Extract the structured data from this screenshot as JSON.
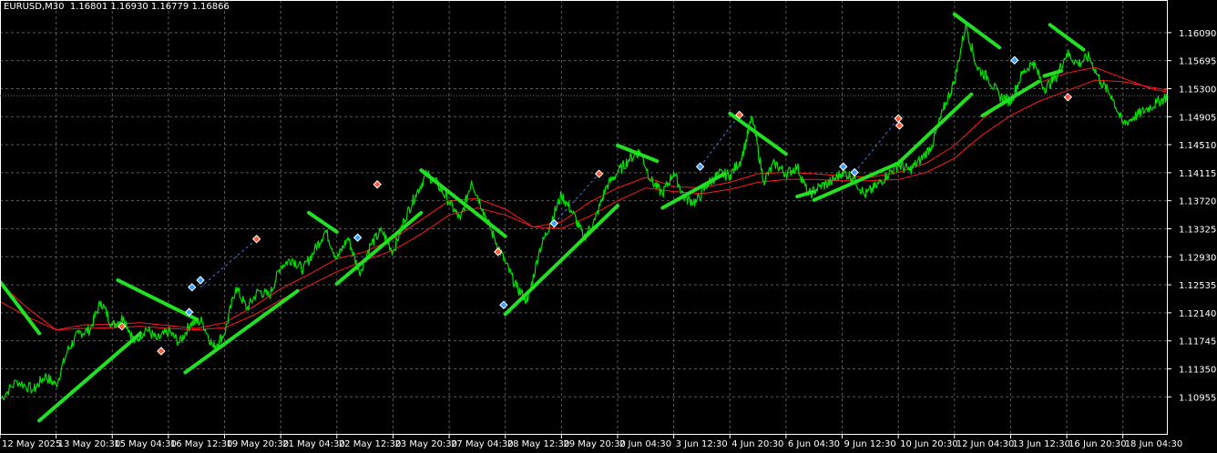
{
  "header": {
    "symbol": "EURUSD,M30",
    "ohlc": "1.16801 1.16930 1.16779 1.16866"
  },
  "chart_data": {
    "type": "line",
    "title": "EURUSD,M30",
    "ylim": [
      1.1042,
      1.1655
    ],
    "grid": true,
    "colors": {
      "background": "#000000",
      "price": "#00e000",
      "ma": "#ff1a1a",
      "trend": "#22e022",
      "grid": "#5a5a5a",
      "axis_text": "#ffffff",
      "buy_arrow": "#3aa0ff",
      "sell_arrow": "#ff5a3a"
    },
    "y_ticks": [
      "1.16090",
      "1.15695",
      "1.15300",
      "1.14905",
      "1.14510",
      "1.14115",
      "1.13720",
      "1.13325",
      "1.12930",
      "1.12535",
      "1.12140",
      "1.11745",
      "1.11350",
      "1.10955"
    ],
    "x_ticks": [
      "12 May 2025",
      "13 May 20:30",
      "15 May 04:30",
      "16 May 12:30",
      "19 May 20:30",
      "21 May 04:30",
      "22 May 12:30",
      "23 May 20:30",
      "27 May 04:30",
      "28 May 12:30",
      "29 May 20:30",
      "2 Jun 04:30",
      "3 Jun 12:30",
      "4 Jun 20:30",
      "6 Jun 04:30",
      "9 Jun 12:30",
      "10 Jun 20:30",
      "12 Jun 04:30",
      "13 Jun 12:30",
      "16 Jun 20:30",
      "18 Jun 04:30"
    ],
    "series": [
      {
        "role": "price",
        "x": [
          0.0,
          0.3,
          0.6,
          0.8,
          1.0,
          1.2,
          1.4,
          1.6,
          1.8,
          2.0,
          2.2,
          2.4,
          2.6,
          2.8,
          3.0,
          3.2,
          3.4,
          3.6,
          3.8,
          4.0,
          4.2,
          4.4,
          4.6,
          4.8,
          5.0,
          5.2,
          5.4,
          5.6,
          5.8,
          6.0,
          6.2,
          6.4,
          6.6,
          6.8,
          7.0,
          7.2,
          7.4,
          7.6,
          7.8,
          8.0,
          8.2,
          8.4,
          8.6,
          8.8,
          9.0,
          9.2,
          9.4,
          9.6,
          9.8,
          10.0,
          10.2,
          10.4,
          10.6,
          10.8,
          11.0,
          11.2,
          11.4,
          11.6,
          11.8,
          12.0,
          12.2,
          12.4,
          12.6,
          12.8,
          13.0,
          13.2,
          13.4,
          13.6,
          13.8,
          14.0,
          14.2,
          14.4,
          14.6,
          14.8,
          15.0,
          15.2,
          15.4,
          15.6,
          15.8,
          16.0,
          16.2,
          16.4,
          16.6,
          16.8,
          17.0,
          17.2,
          17.4,
          17.6,
          17.8,
          18.0,
          18.2,
          18.4,
          18.6,
          18.8,
          19.0,
          19.2,
          19.4,
          19.6,
          19.8,
          20.0,
          20.2,
          20.4,
          20.6,
          20.8
        ],
        "values": [
          1.1092,
          1.1118,
          1.1105,
          1.1125,
          1.1112,
          1.116,
          1.1185,
          1.119,
          1.123,
          1.1196,
          1.1208,
          1.1172,
          1.1192,
          1.1176,
          1.1188,
          1.1172,
          1.12,
          1.1202,
          1.1165,
          1.1185,
          1.125,
          1.122,
          1.1245,
          1.1238,
          1.128,
          1.129,
          1.1275,
          1.1302,
          1.133,
          1.129,
          1.132,
          1.127,
          1.131,
          1.133,
          1.13,
          1.1345,
          1.138,
          1.141,
          1.1395,
          1.137,
          1.1345,
          1.14,
          1.136,
          1.132,
          1.1285,
          1.125,
          1.123,
          1.13,
          1.134,
          1.138,
          1.1355,
          1.132,
          1.1345,
          1.1392,
          1.1412,
          1.143,
          1.1442,
          1.14,
          1.1382,
          1.1412,
          1.1375,
          1.137,
          1.1395,
          1.141,
          1.1408,
          1.143,
          1.149,
          1.14,
          1.1425,
          1.141,
          1.142,
          1.138,
          1.1392,
          1.1398,
          1.1412,
          1.1405,
          1.138,
          1.1392,
          1.1408,
          1.1423,
          1.1415,
          1.143,
          1.145,
          1.15,
          1.154,
          1.162,
          1.156,
          1.1545,
          1.152,
          1.1512,
          1.155,
          1.1568,
          1.153,
          1.1545,
          1.158,
          1.1565,
          1.1575,
          1.154,
          1.152,
          1.148,
          1.149,
          1.15,
          1.151,
          1.152
        ]
      },
      {
        "role": "ma_fast",
        "x": [
          0.0,
          0.5,
          1.0,
          1.5,
          2.0,
          2.5,
          3.0,
          3.5,
          4.0,
          4.5,
          5.0,
          5.5,
          6.0,
          6.5,
          7.0,
          7.5,
          8.0,
          8.5,
          9.0,
          9.5,
          10.0,
          10.5,
          11.0,
          11.5,
          12.0,
          12.5,
          13.0,
          13.5,
          14.0,
          14.5,
          15.0,
          15.5,
          16.0,
          16.5,
          17.0,
          17.5,
          18.0,
          18.5,
          19.0,
          19.5,
          20.0,
          20.5,
          20.8
        ],
        "values": [
          1.1255,
          1.122,
          1.119,
          1.1197,
          1.1198,
          1.12,
          1.1196,
          1.1192,
          1.12,
          1.1222,
          1.1248,
          1.1268,
          1.129,
          1.13,
          1.1318,
          1.1345,
          1.1372,
          1.1375,
          1.136,
          1.1335,
          1.1342,
          1.137,
          1.139,
          1.1405,
          1.1392,
          1.139,
          1.1398,
          1.141,
          1.1412,
          1.141,
          1.1407,
          1.1405,
          1.1412,
          1.1425,
          1.145,
          1.1487,
          1.1518,
          1.1538,
          1.1552,
          1.156,
          1.1545,
          1.153,
          1.1525
        ]
      },
      {
        "role": "ma_slow",
        "x": [
          0.0,
          0.5,
          1.0,
          1.5,
          2.0,
          2.5,
          3.0,
          3.5,
          4.0,
          4.5,
          5.0,
          5.5,
          6.0,
          6.5,
          7.0,
          7.5,
          8.0,
          8.5,
          9.0,
          9.5,
          10.0,
          10.5,
          11.0,
          11.5,
          12.0,
          12.5,
          13.0,
          13.5,
          14.0,
          14.5,
          15.0,
          15.5,
          16.0,
          16.5,
          17.0,
          17.5,
          18.0,
          18.5,
          19.0,
          19.5,
          20.0,
          20.5,
          20.8
        ],
        "values": [
          1.123,
          1.1208,
          1.119,
          1.1192,
          1.1193,
          1.1195,
          1.1192,
          1.119,
          1.1193,
          1.121,
          1.1232,
          1.1252,
          1.1272,
          1.1288,
          1.1302,
          1.1325,
          1.1352,
          1.1362,
          1.1352,
          1.1335,
          1.1333,
          1.135,
          1.1372,
          1.139,
          1.1385,
          1.1382,
          1.1388,
          1.1398,
          1.1402,
          1.1402,
          1.14,
          1.14,
          1.1402,
          1.1412,
          1.1432,
          1.1465,
          1.1492,
          1.1512,
          1.1527,
          1.1542,
          1.154,
          1.1532,
          1.1528
        ]
      }
    ],
    "trend_lines": [
      {
        "x": [
          0.0,
          0.7
        ],
        "values": [
          1.1258,
          1.1185
        ]
      },
      {
        "x": [
          0.7,
          2.5
        ],
        "values": [
          1.1062,
          1.1185
        ]
      },
      {
        "x": [
          2.1,
          3.5
        ],
        "values": [
          1.126,
          1.1205
        ]
      },
      {
        "x": [
          3.3,
          5.3
        ],
        "values": [
          1.113,
          1.1245
        ]
      },
      {
        "x": [
          5.5,
          6.0
        ],
        "values": [
          1.1355,
          1.1328
        ]
      },
      {
        "x": [
          6.0,
          7.5
        ],
        "values": [
          1.1255,
          1.1355
        ]
      },
      {
        "x": [
          7.5,
          9.0
        ],
        "values": [
          1.1415,
          1.1322
        ]
      },
      {
        "x": [
          9.0,
          11.0
        ],
        "values": [
          1.1212,
          1.1365
        ]
      },
      {
        "x": [
          11.0,
          11.7
        ],
        "values": [
          1.145,
          1.1428
        ]
      },
      {
        "x": [
          11.8,
          12.9
        ],
        "values": [
          1.1362,
          1.141
        ]
      },
      {
        "x": [
          13.0,
          14.0
        ],
        "values": [
          1.1495,
          1.1438
        ]
      },
      {
        "x": [
          14.2,
          14.5
        ],
        "values": [
          1.1378,
          1.1385
        ]
      },
      {
        "x": [
          14.5,
          16.0
        ],
        "values": [
          1.1373,
          1.1425
        ]
      },
      {
        "x": [
          16.0,
          17.3
        ],
        "values": [
          1.1425,
          1.1522
        ]
      },
      {
        "x": [
          17.0,
          17.8
        ],
        "values": [
          1.1635,
          1.1588
        ]
      },
      {
        "x": [
          17.5,
          18.5
        ],
        "values": [
          1.1492,
          1.154
        ]
      },
      {
        "x": [
          18.6,
          18.9
        ],
        "values": [
          1.1548,
          1.1555
        ]
      },
      {
        "x": [
          18.7,
          19.3
        ],
        "values": [
          1.162,
          1.1585
        ]
      }
    ],
    "signals": [
      {
        "type": "sell",
        "x": 2.17,
        "value": 1.1195
      },
      {
        "type": "sell",
        "x": 2.87,
        "value": 1.116
      },
      {
        "type": "buy",
        "x": 3.37,
        "value": 1.1215
      },
      {
        "type": "buy",
        "x": 3.42,
        "value": 1.125
      },
      {
        "type": "buy",
        "x": 3.57,
        "value": 1.126
      },
      {
        "type": "sell",
        "x": 4.57,
        "value": 1.1318
      },
      {
        "type": "buy",
        "x": 6.37,
        "value": 1.132
      },
      {
        "type": "sell",
        "x": 6.72,
        "value": 1.1395
      },
      {
        "type": "sell",
        "x": 8.87,
        "value": 1.13
      },
      {
        "type": "buy",
        "x": 8.97,
        "value": 1.1225
      },
      {
        "type": "buy",
        "x": 9.87,
        "value": 1.134
      },
      {
        "type": "sell",
        "x": 10.67,
        "value": 1.141
      },
      {
        "type": "buy",
        "x": 12.47,
        "value": 1.142
      },
      {
        "type": "sell",
        "x": 13.17,
        "value": 1.1493
      },
      {
        "type": "buy",
        "x": 15.02,
        "value": 1.142
      },
      {
        "type": "buy",
        "x": 15.22,
        "value": 1.1412
      },
      {
        "type": "sell",
        "x": 16.0,
        "value": 1.1488
      },
      {
        "type": "sell",
        "x": 16.02,
        "value": 1.1478
      },
      {
        "type": "buy",
        "x": 18.07,
        "value": 1.157
      },
      {
        "type": "sell",
        "x": 19.02,
        "value": 1.1518
      }
    ],
    "dashed_links": [
      {
        "x": [
          3.57,
          4.57
        ],
        "values": [
          1.125,
          1.1318
        ]
      },
      {
        "x": [
          9.87,
          10.67
        ],
        "values": [
          1.134,
          1.141
        ]
      },
      {
        "x": [
          12.47,
          13.17
        ],
        "values": [
          1.142,
          1.1493
        ]
      },
      {
        "x": [
          15.22,
          16.0
        ],
        "values": [
          1.1412,
          1.1488
        ]
      }
    ]
  }
}
